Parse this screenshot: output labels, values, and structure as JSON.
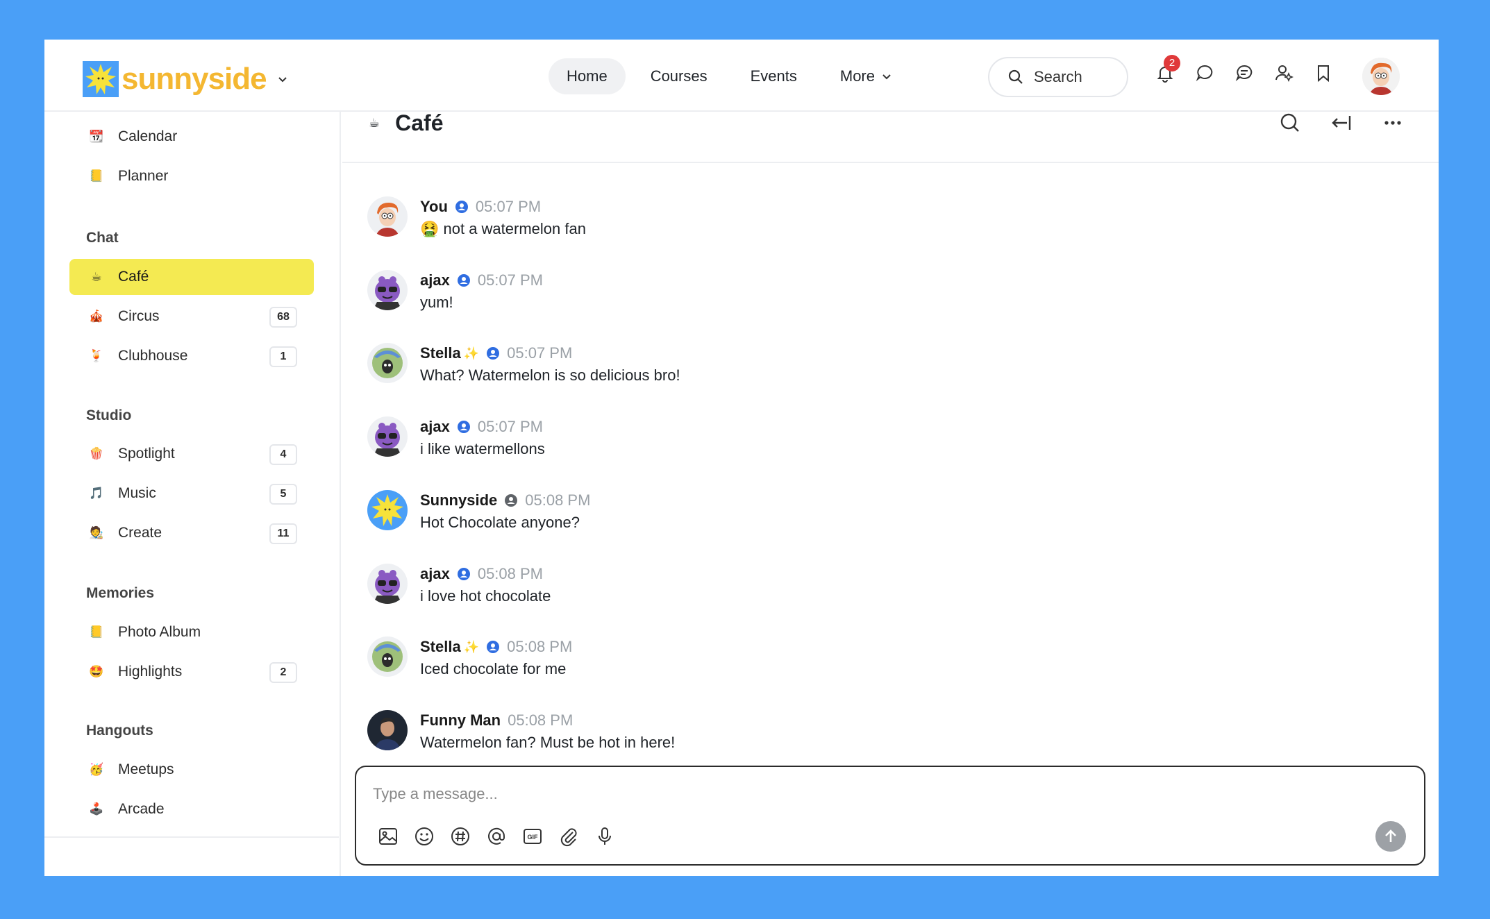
{
  "header": {
    "logo_text": "sunnyside",
    "nav": [
      "Home",
      "Courses",
      "Events",
      "More"
    ],
    "search_label": "Search",
    "notification_count": "2"
  },
  "sidebar": {
    "top_items": [
      {
        "emoji": "📆",
        "label": "Calendar"
      },
      {
        "emoji": "📒",
        "label": "Planner"
      }
    ],
    "groups": [
      {
        "title": "Chat",
        "items": [
          {
            "emoji": "☕",
            "label": "Café",
            "count": ""
          },
          {
            "emoji": "🎪",
            "label": "Circus",
            "count": "68"
          },
          {
            "emoji": "🍹",
            "label": "Clubhouse",
            "count": "1"
          }
        ]
      },
      {
        "title": "Studio",
        "items": [
          {
            "emoji": "🍿",
            "label": "Spotlight",
            "count": "4"
          },
          {
            "emoji": "🎵",
            "label": "Music",
            "count": "5"
          },
          {
            "emoji": "🧑‍🎨",
            "label": "Create",
            "count": "11"
          }
        ]
      },
      {
        "title": "Memories",
        "items": [
          {
            "emoji": "📒",
            "label": "Photo Album",
            "count": ""
          },
          {
            "emoji": "🤩",
            "label": "Highlights",
            "count": "2"
          }
        ]
      },
      {
        "title": "Hangouts",
        "items": [
          {
            "emoji": "🥳",
            "label": "Meetups",
            "count": ""
          },
          {
            "emoji": "🕹️",
            "label": "Arcade",
            "count": ""
          }
        ]
      }
    ]
  },
  "channel": {
    "emoji": "☕",
    "title": "Café"
  },
  "messages": [
    {
      "name": "You",
      "spark": "",
      "time": "05:07 PM",
      "text": "🤮 not a watermelon fan",
      "avatar": "fry",
      "verified": "blue"
    },
    {
      "name": "ajax",
      "spark": "",
      "time": "05:07 PM",
      "text": "yum!",
      "avatar": "ajax",
      "verified": "blue"
    },
    {
      "name": "Stella",
      "spark": "✨",
      "time": "05:07 PM",
      "text": "What? Watermelon is so delicious bro!",
      "avatar": "stella",
      "verified": "blue"
    },
    {
      "name": "ajax",
      "spark": "",
      "time": "05:07 PM",
      "text": "i like watermellons",
      "avatar": "ajax",
      "verified": "blue"
    },
    {
      "name": "Sunnyside",
      "spark": "",
      "time": "05:08 PM",
      "text": "Hot Chocolate anyone?",
      "avatar": "sunnyside",
      "verified": "gray"
    },
    {
      "name": "ajax",
      "spark": "",
      "time": "05:08 PM",
      "text": "i love hot chocolate",
      "avatar": "ajax",
      "verified": "blue"
    },
    {
      "name": "Stella",
      "spark": "✨",
      "time": "05:08 PM",
      "text": "Iced chocolate for me",
      "avatar": "stella",
      "verified": "blue"
    },
    {
      "name": "Funny Man",
      "spark": "",
      "time": "05:08 PM",
      "text": "Watermelon fan? Must be hot in here!",
      "avatar": "funnyman",
      "verified": ""
    }
  ],
  "composer": {
    "placeholder": "Type a message...",
    "tools": [
      "image-icon",
      "emoji-icon",
      "hashtag-icon",
      "mention-icon",
      "gif-icon",
      "attachment-icon",
      "microphone-icon"
    ]
  },
  "colors": {
    "background": "#4a9ff7",
    "active_channel": "#f4ea52",
    "brand_text": "#f4b731",
    "verified_blue": "#2f6de1",
    "badge_red": "#e0393a"
  }
}
